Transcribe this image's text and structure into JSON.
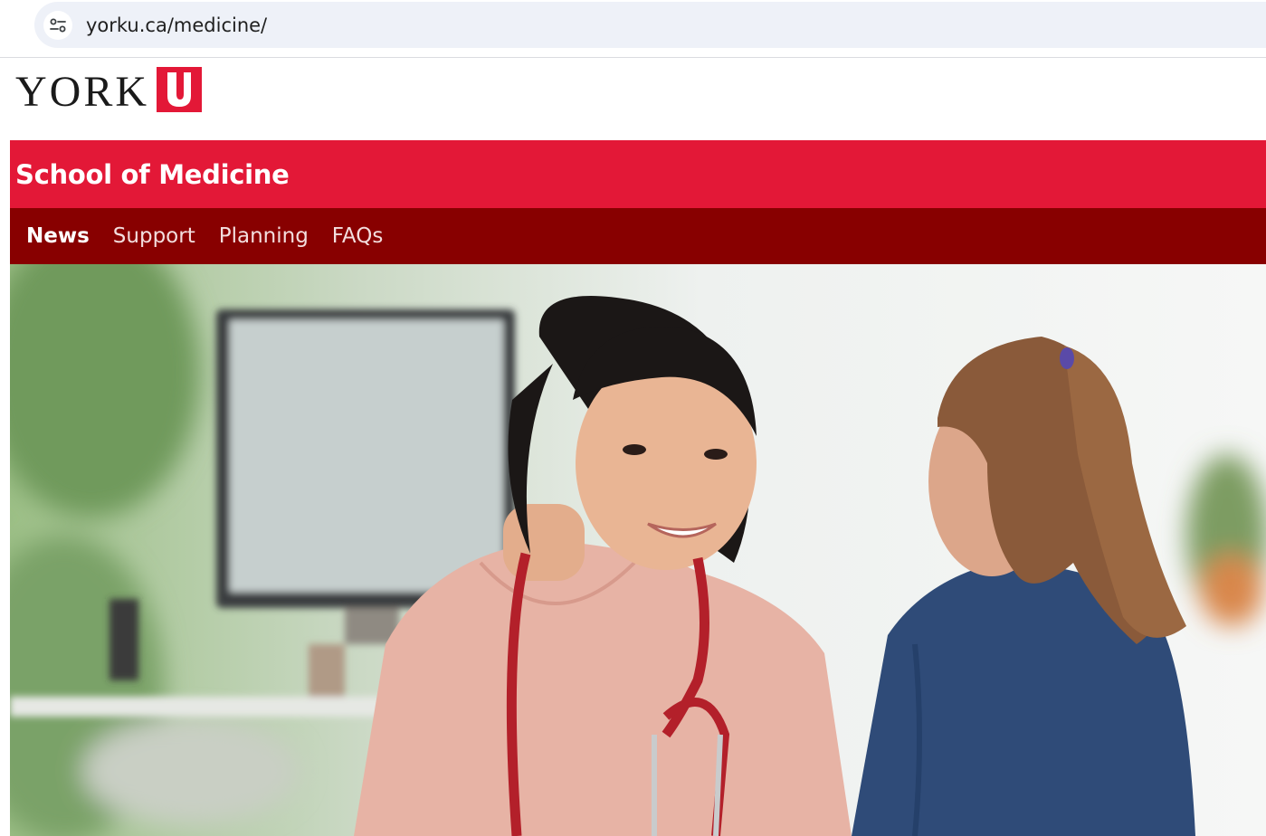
{
  "browser": {
    "url": "yorku.ca/medicine/",
    "site_info_icon": "tune-icon"
  },
  "header": {
    "logo_text": "YORK",
    "logo_mark": "U",
    "logo_mark_color": "#e31837"
  },
  "banner": {
    "title": "School of Medicine",
    "color": "#e31837"
  },
  "nav": {
    "color": "#880000",
    "items": [
      {
        "label": "News"
      },
      {
        "label": "Support"
      },
      {
        "label": "Planning"
      },
      {
        "label": "FAQs"
      }
    ]
  },
  "hero": {
    "image": "doctor-with-child-photo"
  }
}
